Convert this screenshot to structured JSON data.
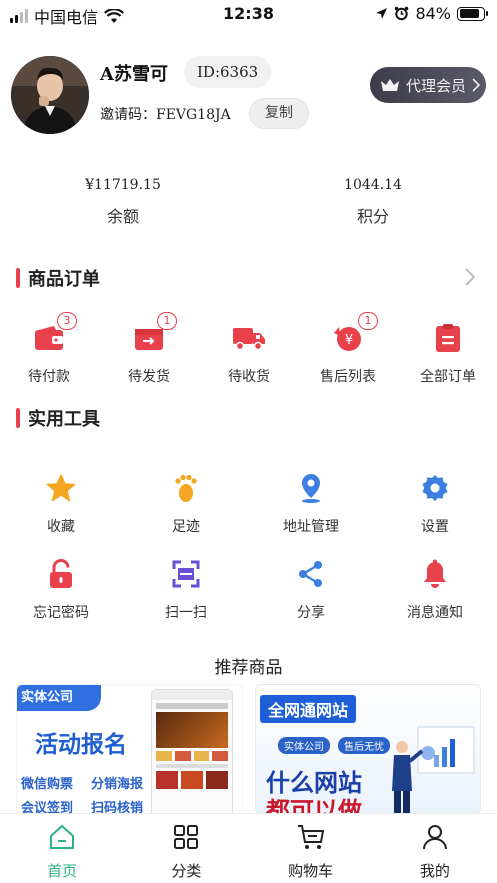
{
  "status": {
    "carrier": "中国电信",
    "time": "12:38",
    "battery": "84%",
    "battery_level": 0.84
  },
  "profile": {
    "name": "A苏雪可",
    "id": "ID:6363",
    "invite": "邀请码：FEVG18JA",
    "copy_label": "复制",
    "vip_label": "代理会员"
  },
  "stats": [
    {
      "value": "¥11719.15",
      "label": "余额"
    },
    {
      "value": "1044.14",
      "label": "积分"
    }
  ],
  "orders": {
    "title": "商品订单",
    "items": [
      {
        "label": "待付款",
        "badge": "3",
        "icon": "wallet-icon"
      },
      {
        "label": "待发货",
        "badge": "1",
        "icon": "shipment-icon"
      },
      {
        "label": "待收货",
        "badge": "",
        "icon": "truck-icon"
      },
      {
        "label": "售后列表",
        "badge": "1",
        "icon": "refund-icon"
      },
      {
        "label": "全部订单",
        "badge": "",
        "icon": "clipboard-icon"
      }
    ]
  },
  "tools": {
    "title": "实用工具",
    "items": [
      {
        "label": "收藏",
        "icon": "star-icon"
      },
      {
        "label": "足迹",
        "icon": "footprint-icon"
      },
      {
        "label": "地址管理",
        "icon": "location-icon"
      },
      {
        "label": "设置",
        "icon": "gear-icon"
      },
      {
        "label": "忘记密码",
        "icon": "lock-icon"
      },
      {
        "label": "扫一扫",
        "icon": "scan-icon"
      },
      {
        "label": "分享",
        "icon": "share-icon"
      },
      {
        "label": "消息通知",
        "icon": "bell-icon"
      }
    ]
  },
  "recommend": {
    "title": "推荐商品",
    "banner1": {
      "tag": "实体公司",
      "headline": "活动报名",
      "lines": [
        "微信购票",
        "分销海报",
        "会议签到",
        "扫码核销"
      ]
    },
    "banner2": {
      "tag": "全网通网站",
      "pill1": "实体公司",
      "pill2": "售后无忧",
      "headline": "什么网站",
      "headline2": "都可以做"
    }
  },
  "tabs": [
    {
      "label": "首页",
      "icon": "home-icon"
    },
    {
      "label": "分类",
      "icon": "category-grid-icon"
    },
    {
      "label": "购物车",
      "icon": "cart-icon"
    },
    {
      "label": "我的",
      "icon": "user-icon"
    }
  ],
  "colors": {
    "accent_red": "#e8414b",
    "tool_orange": "#f5a623",
    "tool_blue": "#3d7fe0",
    "tool_purple": "#6a4fd6",
    "active_green": "#2db380"
  }
}
